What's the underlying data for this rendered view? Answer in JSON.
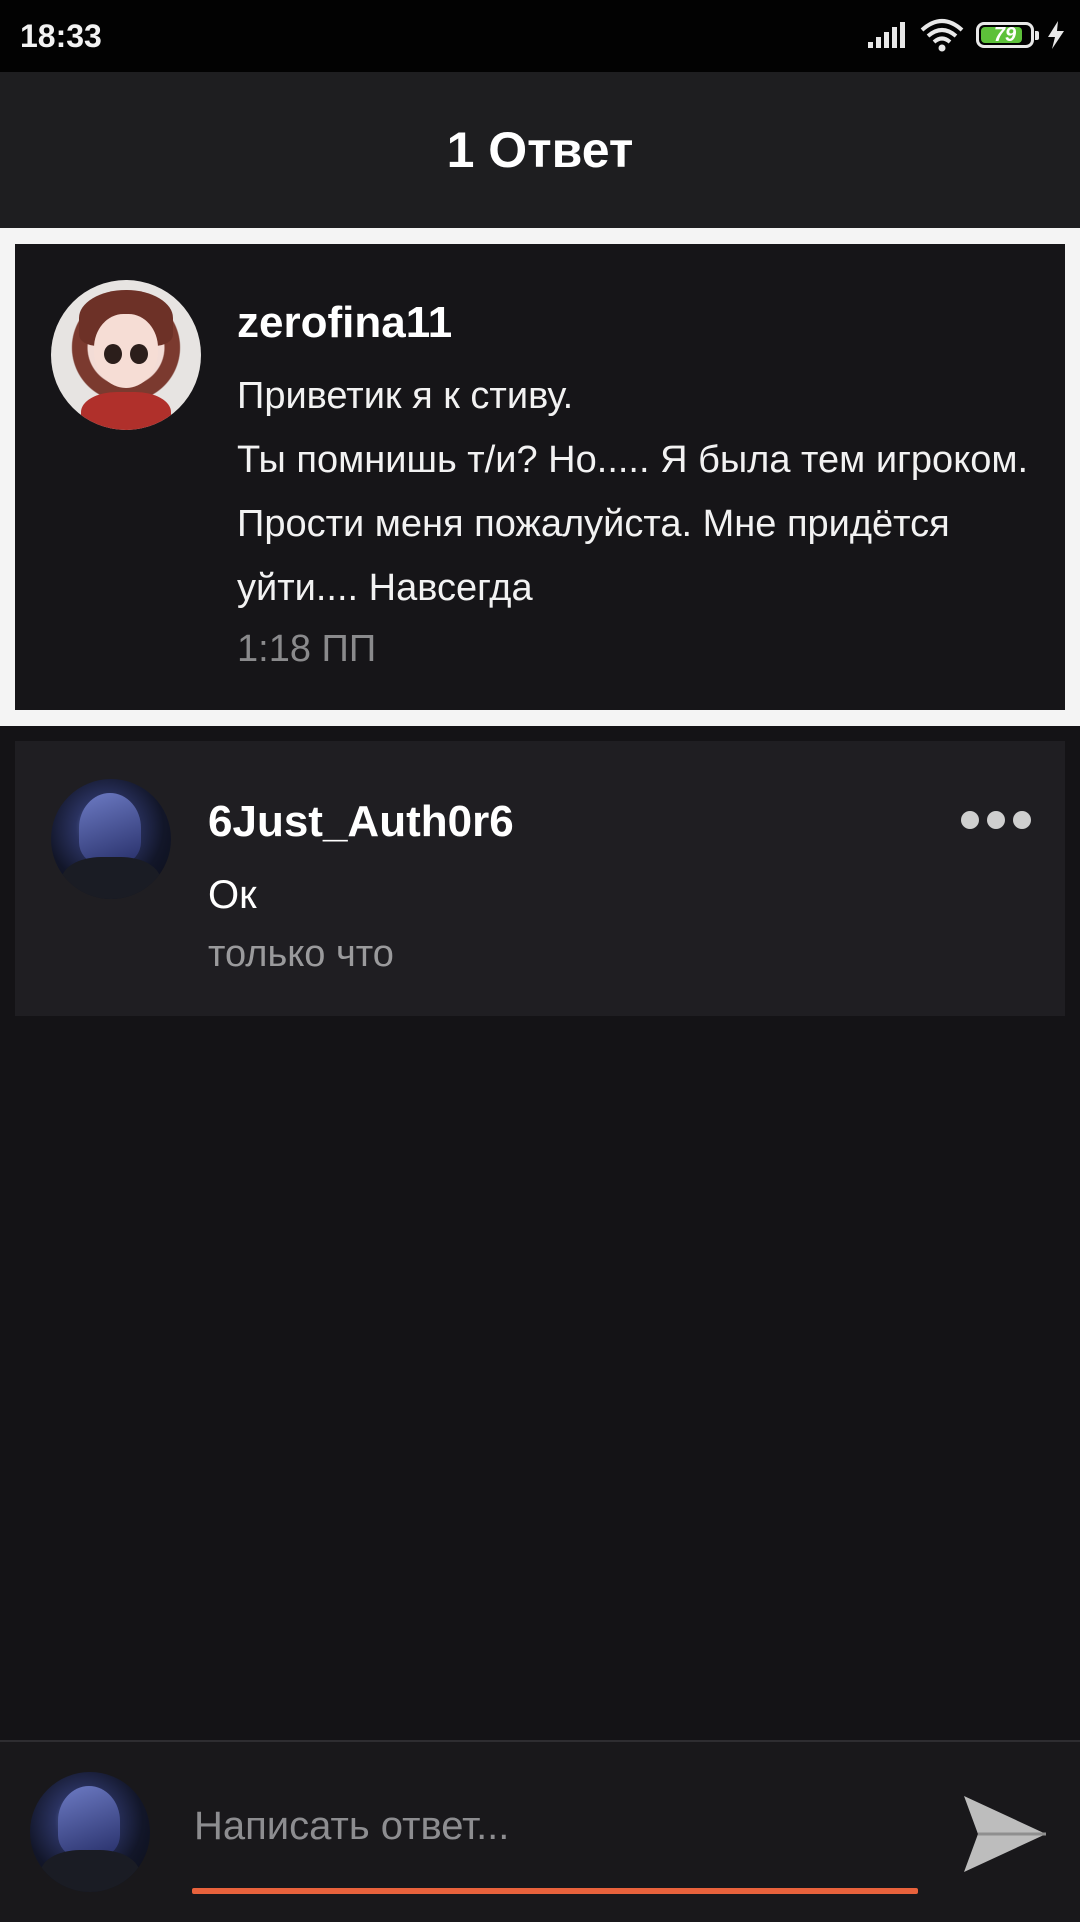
{
  "status_bar": {
    "time": "18:33",
    "battery_level": "79",
    "icons": [
      "signal-icon",
      "wifi-icon",
      "battery-icon",
      "charging-icon"
    ]
  },
  "header": {
    "title": "1 Ответ"
  },
  "original_post": {
    "username": "zerofina11",
    "text": "Приветик я к стиву.\nТы помнишь т/и? Но..... Я была тем игроком. Прости меня пожалуйста. Мне придётся уйти.... Навсегда",
    "time": "1:18 ПП"
  },
  "reply": {
    "username": "6Just_Auth0r6",
    "text": "Ок",
    "time": "только что"
  },
  "composer": {
    "placeholder": "Написать ответ..."
  },
  "colors": {
    "background": "#141316",
    "header": "#1e1e20",
    "accent": "#e8623c",
    "battery": "#5dc13a"
  }
}
